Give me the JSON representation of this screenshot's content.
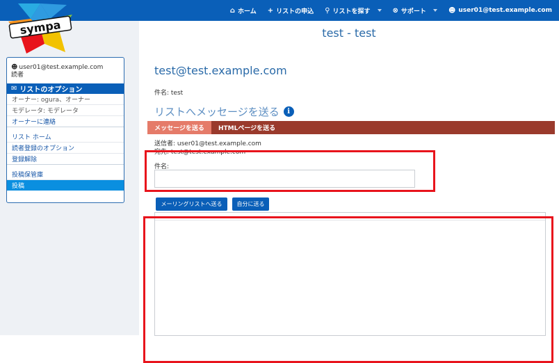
{
  "nav": {
    "home": "ホーム",
    "request": "リストの申込",
    "search": "リストを探す",
    "support": "サポート",
    "user": "user01@test.example.com"
  },
  "logo": {
    "text": "sympa"
  },
  "page_title": "test - test",
  "sidebar": {
    "user_email": "user01@test.example.com",
    "user_role": "読者",
    "options_title": "リストのオプション",
    "owner": "オーナー: ogura、オーナー",
    "moderator": "モデレータ: モデレータ",
    "contact_owner": "オーナーに連絡",
    "list_home": "リスト ホーム",
    "subscriber_options": "読者登録のオプション",
    "unsubscribe": "登録解除",
    "archive": "投稿保管庫",
    "post": "投稿"
  },
  "main": {
    "list_email": "test@test.example.com",
    "subject_line": "件名: test",
    "section_title": "リストへメッセージを送る",
    "tabs": [
      {
        "label": "メッセージを送る"
      },
      {
        "label": "HTMLページを送る"
      }
    ],
    "from": "送信者: user01@test.example.com",
    "to": "宛先: test@test.example.com",
    "subject_label": "件名:",
    "subject_value": "",
    "send_to_list": "メーリングリストへ送る",
    "send_to_self": "自分に送る",
    "body_value": ""
  },
  "colors": {
    "nav_bg": "#0a5fb8",
    "tab_bar": "#9a3a2c",
    "tab_active": "#e57b69",
    "highlight": "#e8141c"
  }
}
